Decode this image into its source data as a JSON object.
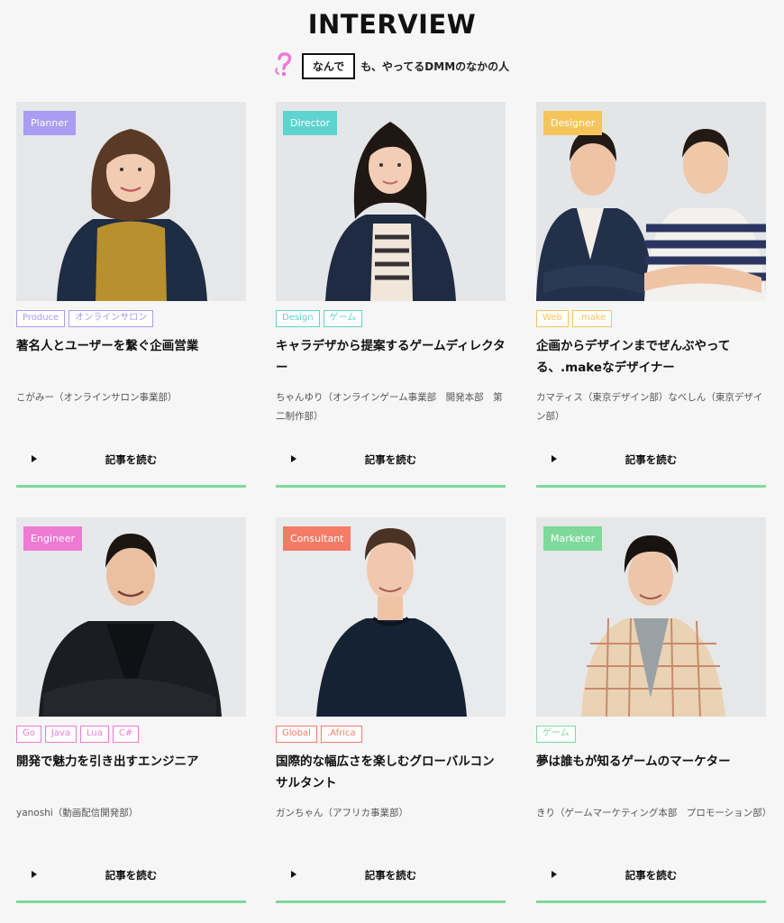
{
  "header": {
    "title": "INTERVIEW",
    "boxed": "なんで",
    "tail": "も、やってるDMMのなかの人"
  },
  "colors": {
    "planner": "#a99cf2",
    "director": "#5fd3cf",
    "designer": "#f5c55c",
    "engineer": "#ee7ad3",
    "consultant": "#f47b66",
    "marketer": "#7fd99b",
    "underline": "#7fd99b"
  },
  "cards": [
    {
      "role": "Planner",
      "tags": [
        "Produce",
        "オンラインサロン"
      ],
      "headline": "著名人とユーザーを繋ぐ企画営業",
      "author": "こがみー（オンラインサロン事業部）",
      "read_label": "記事を読む"
    },
    {
      "role": "Director",
      "tags": [
        "Design",
        "ゲーム"
      ],
      "headline": "キャラデザから提案するゲームディレクター",
      "author": "ちゃんゆり（オンラインゲーム事業部　開発本部　第二制作部）",
      "read_label": "記事を読む"
    },
    {
      "role": "Designer",
      "tags": [
        "Web",
        ".make"
      ],
      "headline": "企画からデザインまでぜんぶやってる、.makeなデザイナー",
      "author": "カマティス（東京デザイン部）なべしん（東京デザイン部）",
      "read_label": "記事を読む"
    },
    {
      "role": "Engineer",
      "tags": [
        "Go",
        "Java",
        "Lua",
        "C#"
      ],
      "headline": "開発で魅力を引き出すエンジニア",
      "author": "yanoshi（動画配信開発部）",
      "read_label": "記事を読む"
    },
    {
      "role": "Consultant",
      "tags": [
        "Global",
        ".Africa"
      ],
      "headline": "国際的な幅広さを楽しむグローバルコンサルタント",
      "author": "ガンちゃん（アフリカ事業部）",
      "read_label": "記事を読む"
    },
    {
      "role": "Marketer",
      "tags": [
        "ゲーム"
      ],
      "headline": "夢は誰もが知るゲームのマーケター",
      "author": "きり（ゲームマーケティング本部　プロモーション部）",
      "read_label": "記事を読む"
    }
  ]
}
